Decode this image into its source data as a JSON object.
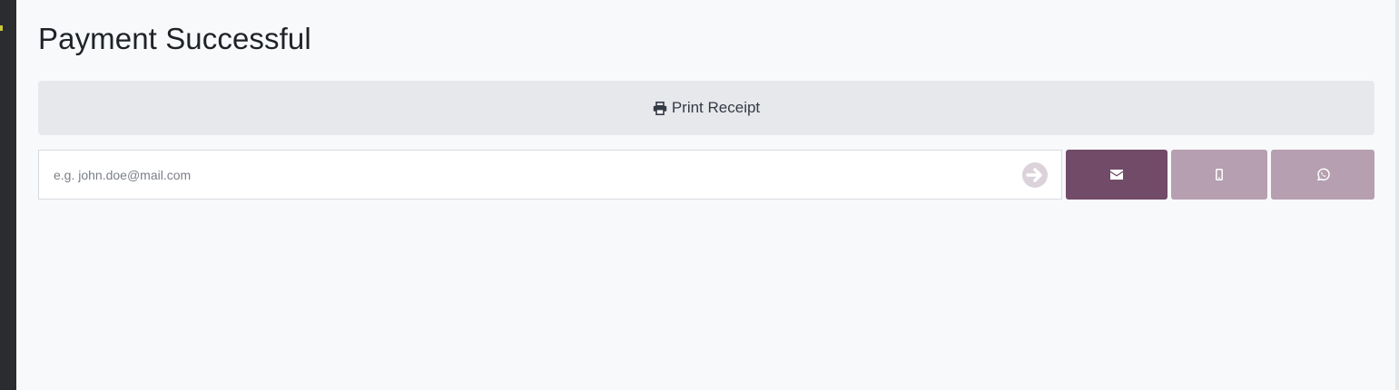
{
  "page": {
    "title": "Payment Successful"
  },
  "actions": {
    "print_label": "Print Receipt"
  },
  "receipt_send": {
    "email_placeholder": "e.g. john.doe@mail.com",
    "email_value": "",
    "channels": [
      {
        "name": "email",
        "icon": "envelope-icon",
        "selected": true
      },
      {
        "name": "sms",
        "icon": "mobile-icon",
        "selected": false
      },
      {
        "name": "whatsapp",
        "icon": "whatsapp-icon",
        "selected": false
      }
    ]
  },
  "colors": {
    "accent": "#714b67",
    "accent_muted": "#b59fb0",
    "print_button_bg": "#e7e8eb",
    "page_bg": "#f8f9fb"
  }
}
